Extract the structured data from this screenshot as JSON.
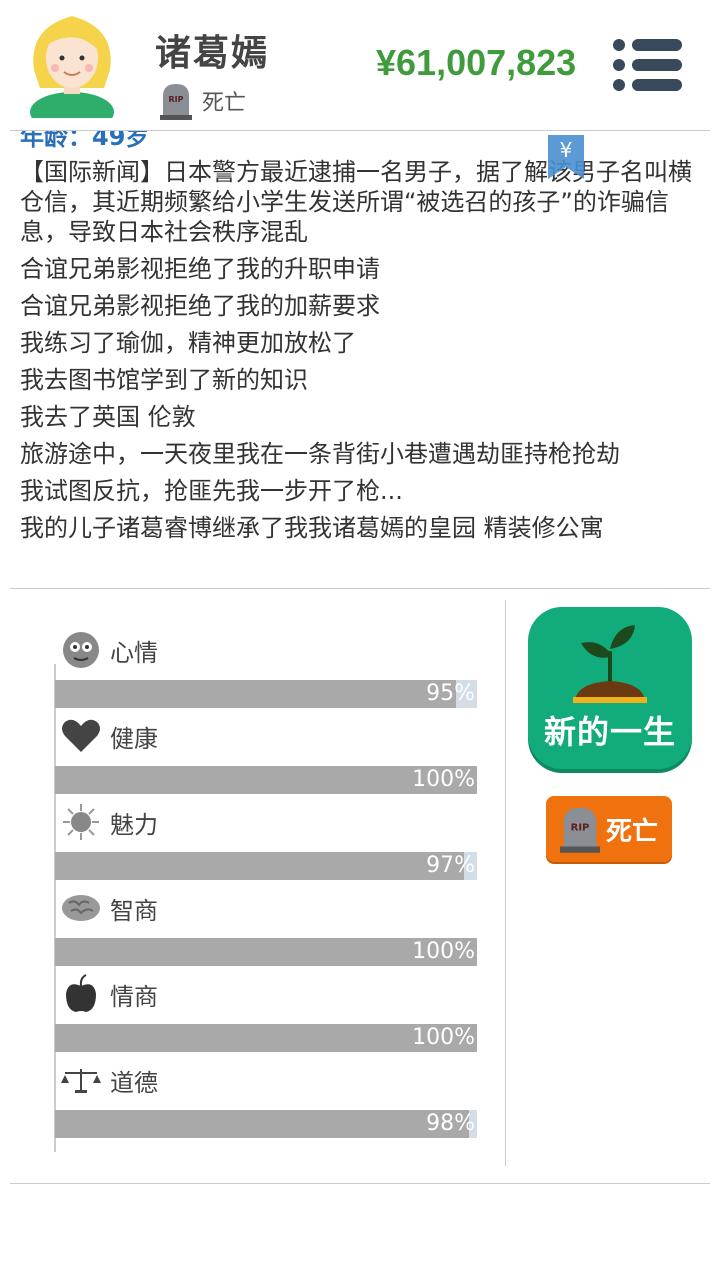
{
  "header": {
    "name": "诸葛嫣",
    "status": "死亡",
    "money": "¥61,007,823"
  },
  "log": {
    "age": "年龄：49岁",
    "yen_icon": "¥",
    "entries": [
      "【国际新闻】日本警方最近逮捕一名男子，据了解该男子名叫横仓信，其近期频繁给小学生发送所谓“被选召的孩子”的诈骗信息，导致日本社会秩序混乱",
      "合谊兄弟影视拒绝了我的升职申请",
      "合谊兄弟影视拒绝了我的加薪要求",
      "我练习了瑜伽，精神更加放松了",
      "我去图书馆学到了新的知识",
      "我去了英国 伦敦",
      "旅游途中，一天夜里我在一条背街小巷遭遇劫匪持枪抢劫",
      "我试图反抗，抢匪先我一步开了枪...",
      "我的儿子诸葛睿博继承了我我诸葛嫣的皇园 精装修公寓"
    ]
  },
  "stats": [
    {
      "label": "心情",
      "icon": "face-icon",
      "value": 95,
      "text": "95%"
    },
    {
      "label": "健康",
      "icon": "heart-icon",
      "value": 100,
      "text": "100%"
    },
    {
      "label": "魅力",
      "icon": "sun-icon",
      "value": 97,
      "text": "97%"
    },
    {
      "label": "智商",
      "icon": "brain-icon",
      "value": 100,
      "text": "100%"
    },
    {
      "label": "情商",
      "icon": "apple-icon",
      "value": 100,
      "text": "100%"
    },
    {
      "label": "道德",
      "icon": "scales-icon",
      "value": 98,
      "text": "98%"
    }
  ],
  "actions": {
    "new_life": "新的一生",
    "death": "死亡"
  },
  "colors": {
    "money": "#3f9b3b",
    "new_life_button": "#12ab7b",
    "death_button": "#f0720e",
    "bar_fill": "#a9a9a9",
    "bar_track": "#d3dde6"
  }
}
